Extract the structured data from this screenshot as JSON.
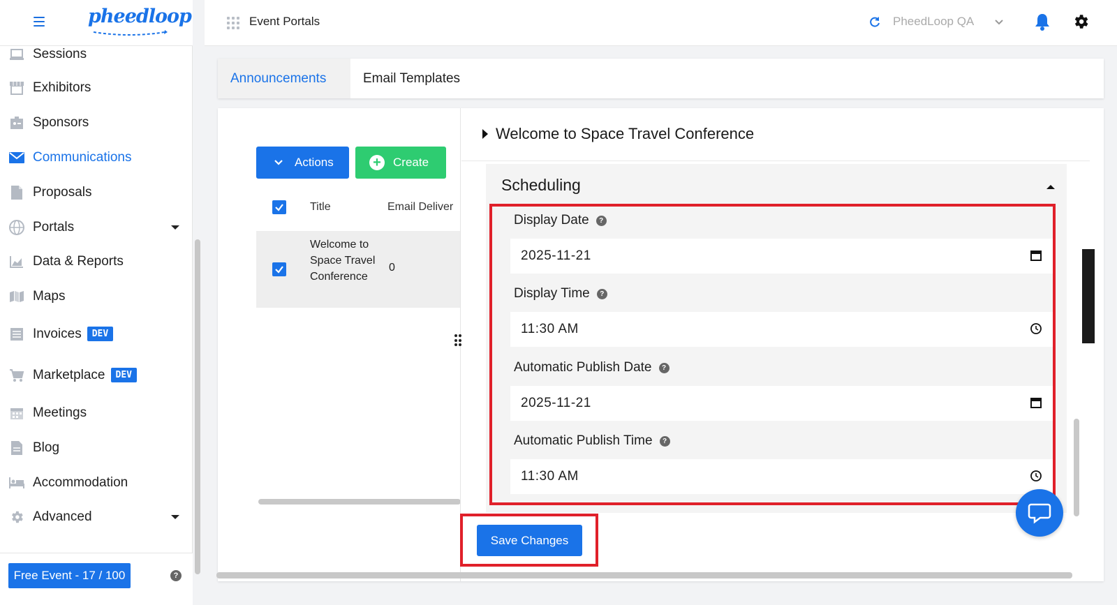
{
  "app": {
    "logo_text": "pheedloop"
  },
  "topbar": {
    "title": "Event Portals",
    "org_name": "PheedLoop QA"
  },
  "sidebar": {
    "items": [
      {
        "label": "Sessions",
        "icon": "monitor-icon"
      },
      {
        "label": "Exhibitors",
        "icon": "storefront-icon"
      },
      {
        "label": "Sponsors",
        "icon": "badge-icon"
      },
      {
        "label": "Communications",
        "icon": "envelope-icon"
      },
      {
        "label": "Proposals",
        "icon": "document-icon"
      },
      {
        "label": "Portals",
        "icon": "globe-icon"
      },
      {
        "label": "Data & Reports",
        "icon": "chart-icon"
      },
      {
        "label": "Maps",
        "icon": "map-icon"
      },
      {
        "label": "Invoices",
        "icon": "list-icon",
        "badge": "DEV"
      },
      {
        "label": "Marketplace",
        "icon": "cart-icon",
        "badge": "DEV"
      },
      {
        "label": "Meetings",
        "icon": "calendar-icon"
      },
      {
        "label": "Blog",
        "icon": "document-icon"
      },
      {
        "label": "Accommodation",
        "icon": "bed-icon"
      },
      {
        "label": "Advanced",
        "icon": "gear-icon"
      }
    ],
    "footer": {
      "plan_label": "Free Event - 17 / 100"
    }
  },
  "tabs": [
    {
      "label": "Announcements"
    },
    {
      "label": "Email Templates"
    }
  ],
  "toolbar": {
    "actions_label": "Actions",
    "create_label": "Create"
  },
  "table": {
    "headers": {
      "title": "Title",
      "email_delivery": "Email Deliver"
    },
    "rows": [
      {
        "title": "Welcome to Space Travel Conference",
        "email_delivery": "0"
      }
    ]
  },
  "announcement": {
    "title": "Welcome to Space Travel Conference"
  },
  "scheduling": {
    "title": "Scheduling",
    "display_date_label": "Display Date",
    "display_date": "2025-11-21",
    "display_time_label": "Display Time",
    "display_time": "11:30  AM",
    "publish_date_label": "Automatic Publish Date",
    "publish_date": "2025-11-21",
    "publish_time_label": "Automatic Publish Time",
    "publish_time": "11:30  AM"
  },
  "save_label": "Save Changes",
  "colors": {
    "accent": "#1a73e8",
    "create": "#2ecc71",
    "highlight": "#e0202a"
  }
}
